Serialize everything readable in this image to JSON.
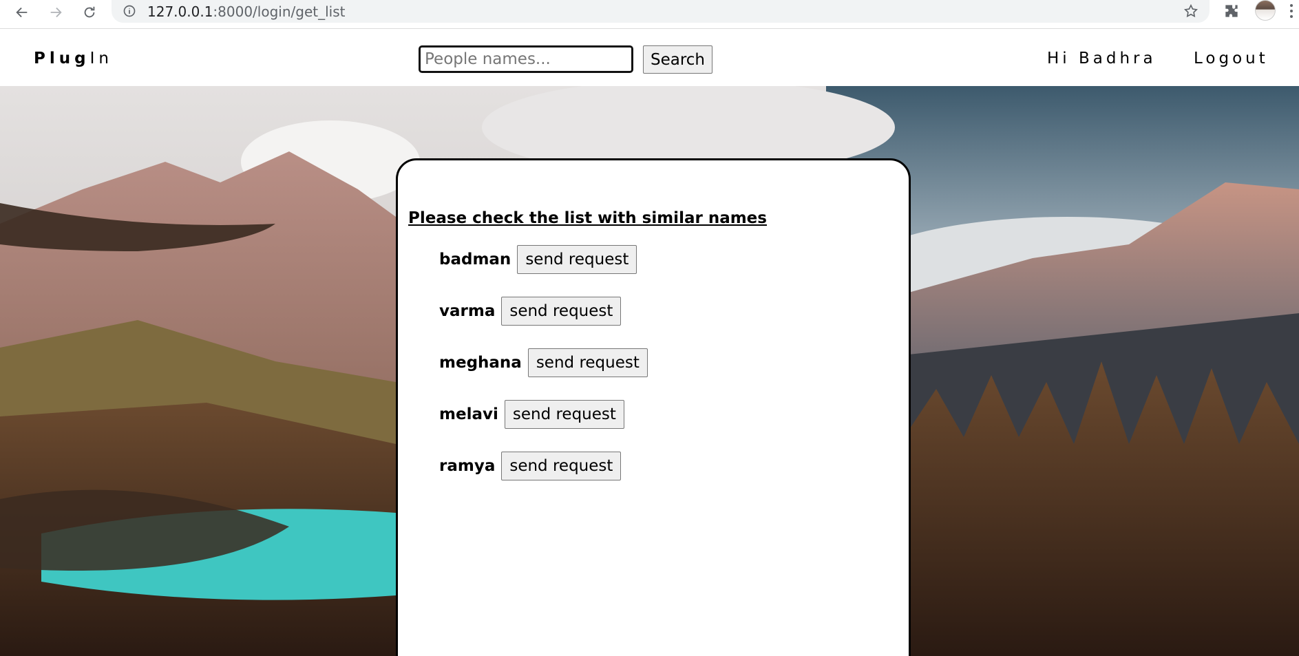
{
  "browser": {
    "url_host": "127.0.0.1",
    "url_path": ":8000/login/get_list"
  },
  "header": {
    "logo_bold": "Plug",
    "logo_light": "In",
    "search_placeholder": "People names...",
    "search_button_label": "Search",
    "greeting": "Hi Badhra",
    "logout_label": "Logout"
  },
  "card": {
    "heading": "Please check the list with similar names",
    "people": [
      {
        "name": "badman",
        "button_label": "send request"
      },
      {
        "name": "varma",
        "button_label": "send request"
      },
      {
        "name": "meghana",
        "button_label": "send request"
      },
      {
        "name": "melavi",
        "button_label": "send request"
      },
      {
        "name": "ramya",
        "button_label": "send request"
      }
    ]
  },
  "colors": {
    "card_border": "#000000",
    "button_bg": "#efefef",
    "chrome_omnibox": "#f1f3f4"
  }
}
